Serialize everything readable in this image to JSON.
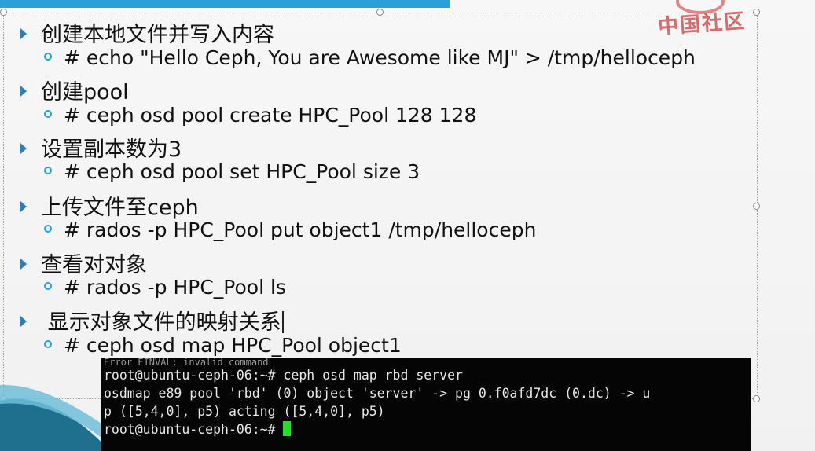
{
  "slide": {
    "logo_text": "中国社区",
    "bullets": [
      {
        "level": 1,
        "text": "创建本地文件并写入内容"
      },
      {
        "level": 2,
        "text": "# echo \"Hello Ceph, You are Awesome like MJ\" >  /tmp/helloceph"
      },
      {
        "level": 1,
        "text": "创建pool"
      },
      {
        "level": 2,
        "text": "# ceph osd pool create HPC_Pool 128 128"
      },
      {
        "level": 1,
        "text": "设置副本数为3"
      },
      {
        "level": 2,
        "text": "# ceph osd pool set HPC_Pool size 3"
      },
      {
        "level": 1,
        "text": "上传文件至ceph"
      },
      {
        "level": 2,
        "text": "# rados -p HPC_Pool put object1  /tmp/helloceph"
      },
      {
        "level": 1,
        "text": "查看对对象"
      },
      {
        "level": 2,
        "text": "# rados -p HPC_Pool ls"
      },
      {
        "level": 1,
        "text": " 显示对象文件的映射关系"
      },
      {
        "level": 2,
        "text": "# ceph osd map HPC_Pool object1"
      }
    ]
  },
  "terminal": {
    "partial_line": "Error EINVAL: invalid command",
    "lines": [
      "root@ubuntu-ceph-06:~# ceph osd map rbd server",
      "osdmap e89 pool 'rbd' (0) object 'server' -> pg 0.f0afd7dc (0.dc) -> u",
      "p ([5,4,0], p5) acting ([5,4,0], p5)"
    ],
    "prompt": "root@ubuntu-ceph-06:~# "
  },
  "colors": {
    "accent_blue": "#2a9fd8",
    "terminal_bg": "#050505",
    "cursor_green": "#22e022",
    "logo_red": "#d23b3b"
  }
}
